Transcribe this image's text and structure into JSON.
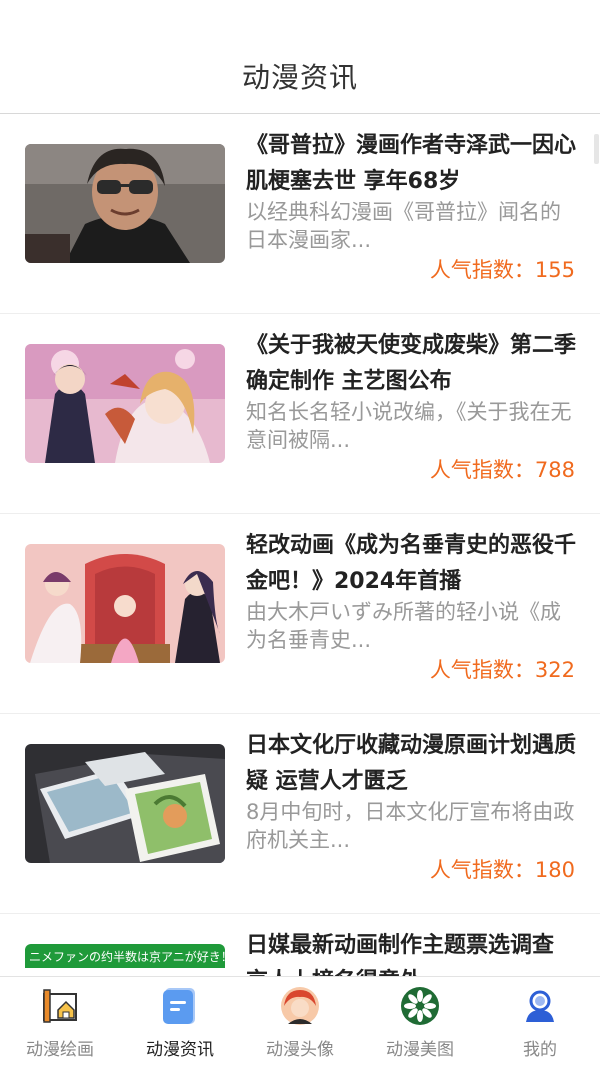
{
  "header": {
    "title": "动漫资讯"
  },
  "popularity_label": "人气指数：",
  "articles": [
    {
      "title": "《哥普拉》漫画作者寺泽武一因心肌梗塞去世 享年68岁",
      "summary": "以经典科幻漫画《哥普拉》闻名的日本漫画家...",
      "popularity": "155"
    },
    {
      "title": "《关于我被天使变成废柴》第二季确定制作 主艺图公布",
      "summary": "知名长名轻小说改编，《关于我在无意间被隔...",
      "popularity": "788"
    },
    {
      "title": "轻改动画《成为名垂青史的恶役千金吧！》2024年首播",
      "summary": "由大木戸いずみ所著的轻小说《成为名垂青史...",
      "popularity": "322"
    },
    {
      "title": "日本文化厅收藏动漫原画计划遇质疑 运营人才匮乏",
      "summary": "8月中旬时，日本文化厅宣布将由政府机关主...",
      "popularity": "180"
    },
    {
      "title": "日媒最新动画制作主题票选调查 京人上榜名得意外",
      "summary": "",
      "popularity": "",
      "thumb_text": "ニメファンの约半数は京アニが好き！"
    }
  ],
  "tabs": [
    {
      "label": "动漫绘画",
      "icon": "drawing-board-icon"
    },
    {
      "label": "动漫资讯",
      "icon": "news-document-icon",
      "active": true
    },
    {
      "label": "动漫头像",
      "icon": "avatar-face-icon"
    },
    {
      "label": "动漫美图",
      "icon": "flower-badge-icon"
    },
    {
      "label": "我的",
      "icon": "user-profile-icon"
    }
  ],
  "colors": {
    "accent": "#f06a1e",
    "active_tab_icon": "#5b9bf0",
    "summary_text": "#999999"
  }
}
